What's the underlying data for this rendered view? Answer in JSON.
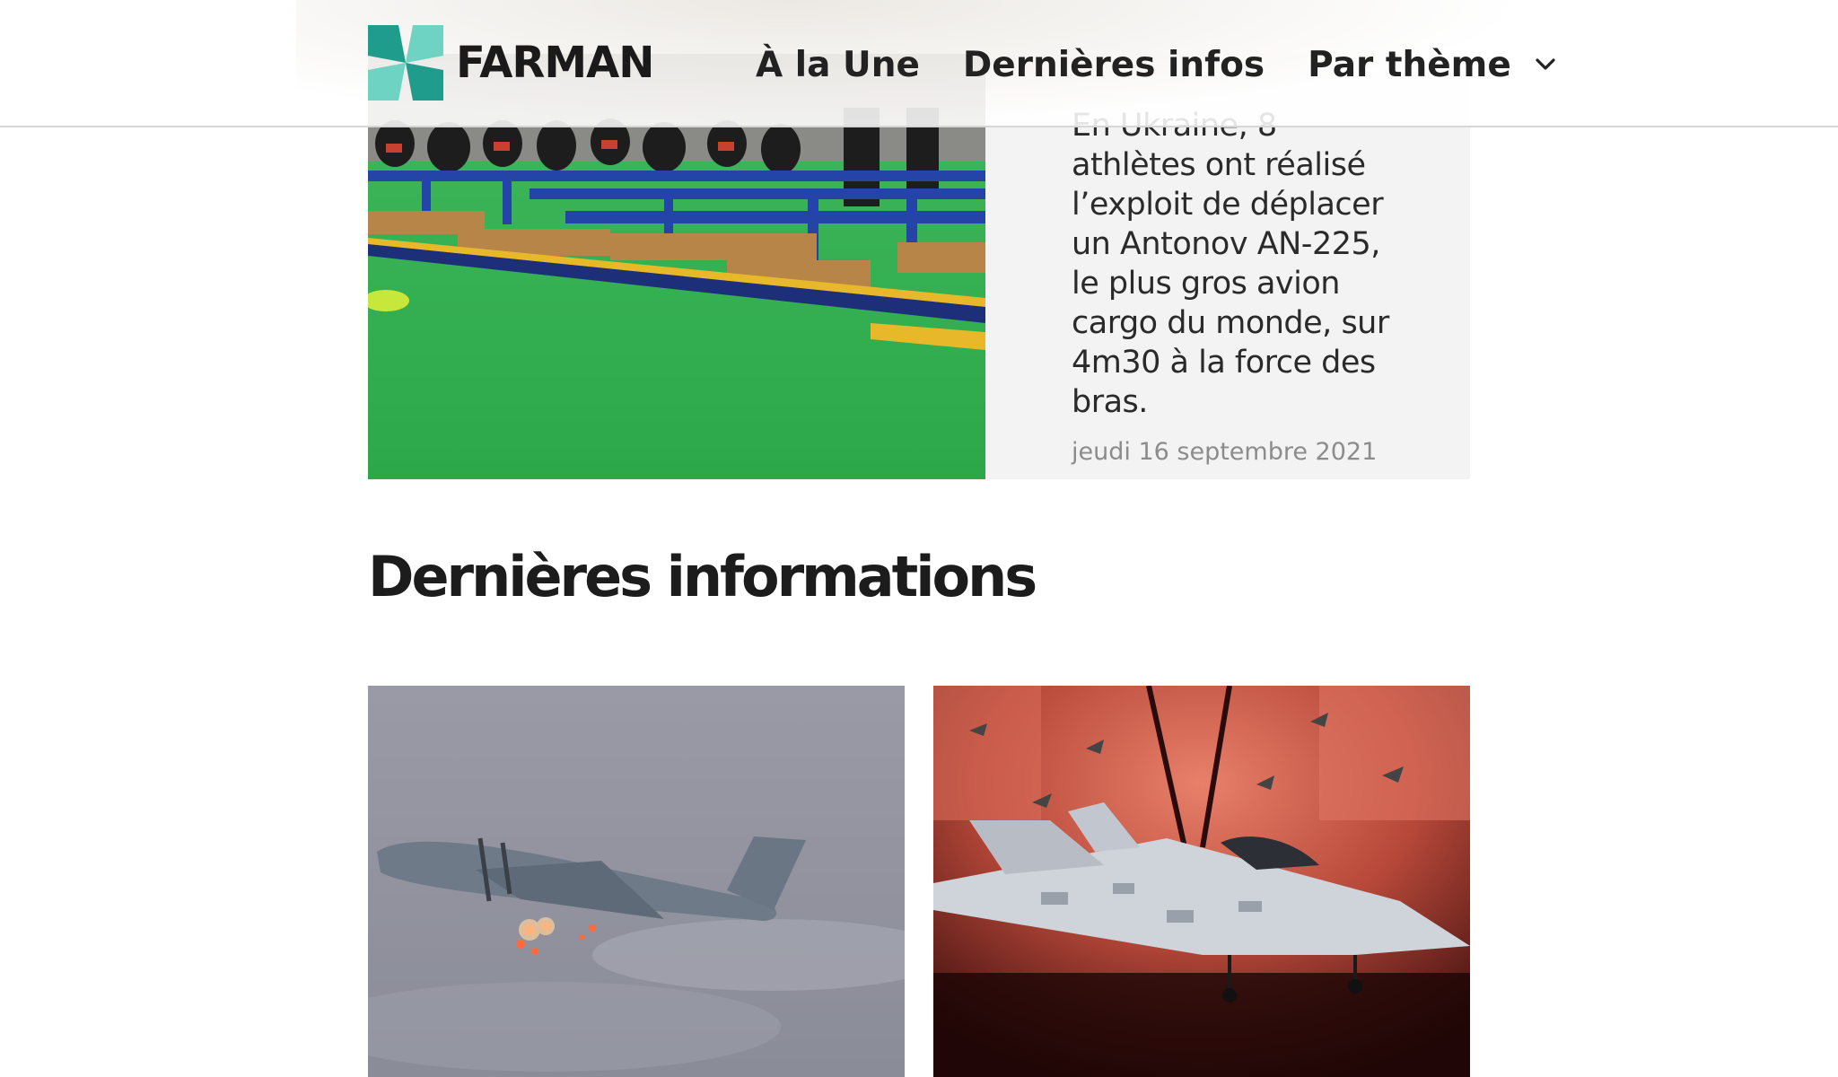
{
  "header": {
    "logo_text": "FARMAN",
    "logo_icon": "pinwheel-logo-icon",
    "nav": [
      {
        "label": "À la Une"
      },
      {
        "label": "Dernières infos"
      },
      {
        "label": "Par thème",
        "icon": "chevron-down-icon"
      }
    ]
  },
  "featured": {
    "summary": "En Ukraine, 8 athlètes ont réalisé l’exploit de déplacer un Antonov AN-225, le plus gros avion cargo du monde, sur 4m30 à la force des bras.",
    "date": "jeudi 16 septembre 2021"
  },
  "latest": {
    "title": "Dernières informations",
    "cards": [
      {
        "image": "military-cargo-plane-firing-flares"
      },
      {
        "image": "stealth-fighter-jet-on-red-stage"
      }
    ]
  },
  "colors": {
    "logo_teal_dark": "#1f9c8c",
    "logo_teal_light": "#6fd3c4",
    "featured_bg": "#f3f3f3",
    "date_gray": "#8c8c8c"
  }
}
